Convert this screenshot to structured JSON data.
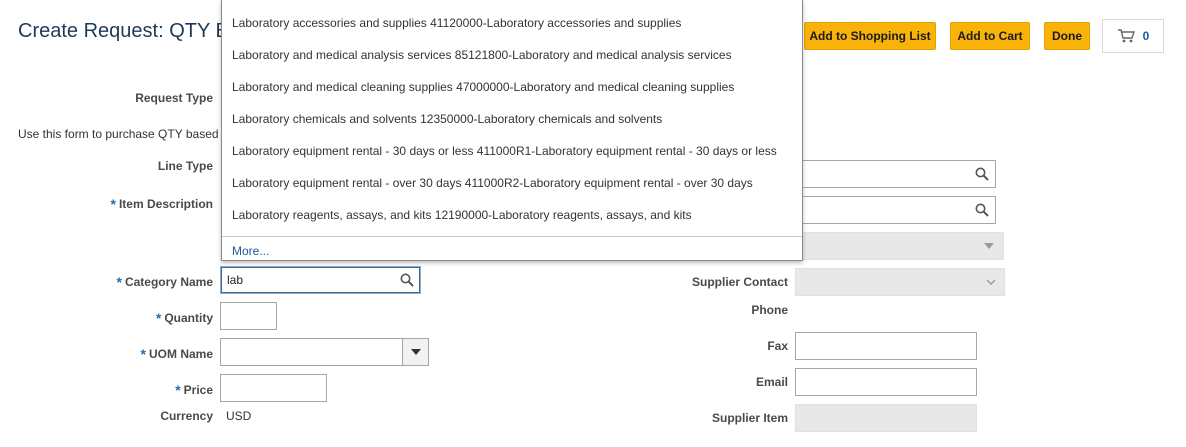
{
  "page": {
    "title": "Create Request: QTY B",
    "instructions": "Use this form to purchase QTY based"
  },
  "toolbar": {
    "add_to_shopping_list": "Add to Shopping List",
    "add_to_cart": "Add to Cart",
    "done": "Done",
    "cart_count": "0"
  },
  "form": {
    "request_type_label": "Request Type",
    "line_type_label": "Line Type",
    "item_description_label": "Item Description",
    "category_name_label": "Category Name",
    "category_name_value": "lab",
    "quantity_label": "Quantity",
    "uom_name_label": "UOM Name",
    "price_label": "Price",
    "currency_label": "Currency",
    "currency_value": "USD",
    "required_marker": "*"
  },
  "supplier": {
    "contact_label": "Supplier Contact",
    "phone_label": "Phone",
    "fax_label": "Fax",
    "email_label": "Email",
    "item_label": "Supplier Item"
  },
  "dropdown": {
    "items": [
      "Laboratory accessories and supplies 41120000-Laboratory accessories and supplies",
      "Laboratory and medical analysis services 85121800-Laboratory and medical analysis services",
      "Laboratory and medical cleaning supplies 47000000-Laboratory and medical cleaning supplies",
      "Laboratory chemicals and solvents 12350000-Laboratory chemicals and solvents",
      "Laboratory equipment rental - 30 days or less 411000R1-Laboratory equipment rental - 30 days or less",
      "Laboratory equipment rental - over 30 days 411000R2-Laboratory equipment rental - over 30 days",
      "Laboratory reagents, assays, and kits 12190000-Laboratory reagents, assays, and kits"
    ],
    "more": "More..."
  },
  "colors": {
    "accent_button": "#f9b308",
    "title": "#1f3a57",
    "link": "#1f5a99",
    "required": "#1f6fb3"
  },
  "icons": [
    "search-icon",
    "cart-icon",
    "chevron-down-icon"
  ]
}
